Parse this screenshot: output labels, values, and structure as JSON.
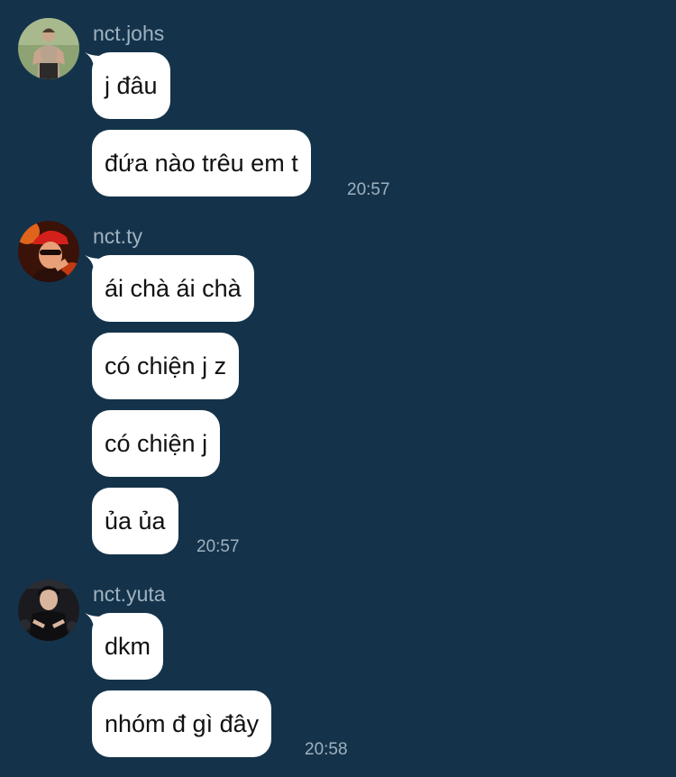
{
  "theme": {
    "background": "#14334a",
    "bubble": "#ffffff",
    "meta_text": "#9fb1bf"
  },
  "groups": [
    {
      "sender": "nct.johs",
      "avatar_icon": "user-photo-icon",
      "messages": [
        "j đâu",
        "đứa nào trêu em t"
      ],
      "time": "20:57"
    },
    {
      "sender": "nct.ty",
      "avatar_icon": "user-photo-icon",
      "messages": [
        "ái chà ái chà",
        "có chiện j z",
        "có chiện j",
        "ủa ủa"
      ],
      "time": "20:57"
    },
    {
      "sender": "nct.yuta",
      "avatar_icon": "user-photo-icon",
      "messages": [
        "dkm",
        "nhóm đ gì đây"
      ],
      "time": "20:58"
    }
  ]
}
